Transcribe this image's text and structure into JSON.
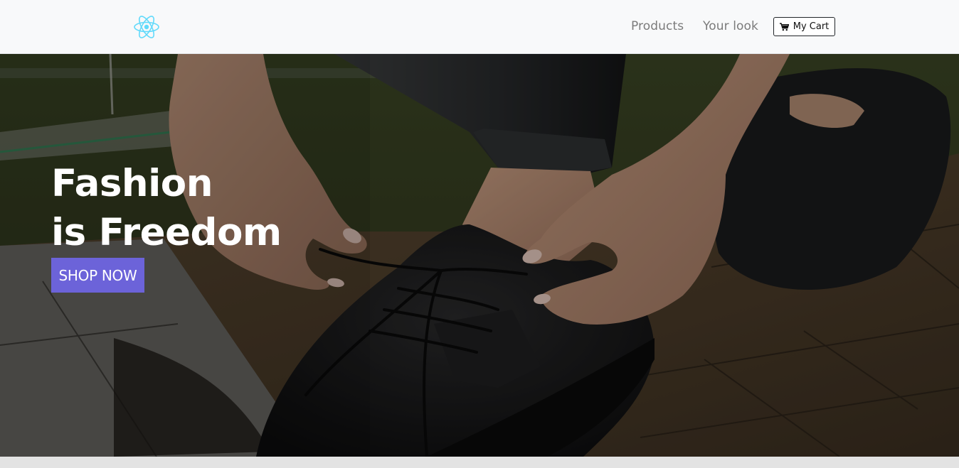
{
  "navbar": {
    "logo_icon": "react-atom-icon",
    "logo_color": "#61dafb",
    "links": [
      {
        "label": "Products"
      },
      {
        "label": "Your look"
      }
    ],
    "cart": {
      "icon": "shopping-cart-icon",
      "label": "My Cart"
    }
  },
  "hero": {
    "title_line1": "Fashion",
    "title_line2": "is Freedom",
    "cta_label": "SHOP NOW",
    "cta_color": "#6c63d9"
  }
}
